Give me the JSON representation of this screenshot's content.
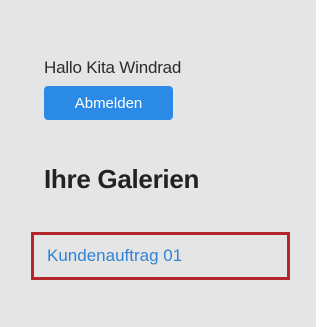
{
  "user": {
    "greeting": "Hallo Kita Windrad",
    "logout_label": "Abmelden"
  },
  "galleries": {
    "heading": "Ihre Galerien",
    "items": [
      {
        "label": "Kundenauftrag 01"
      }
    ]
  },
  "colors": {
    "panel_background": "#e5e5e5",
    "button_background": "#2a8ae6",
    "link": "#2f84d4",
    "highlight_border": "#b5262d"
  }
}
